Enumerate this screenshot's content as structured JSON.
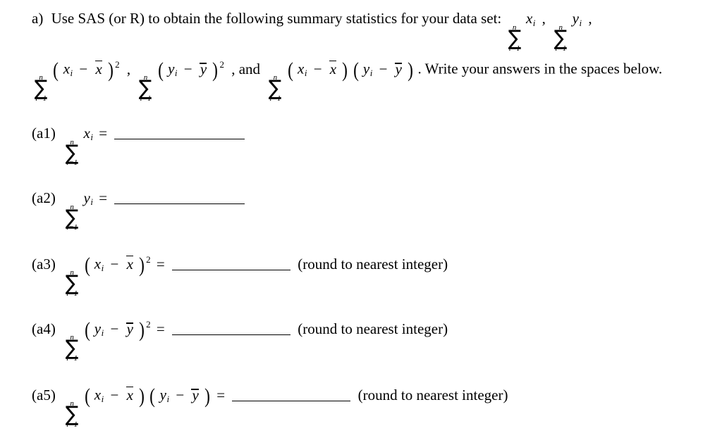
{
  "document": {
    "type": "math-worksheet-question",
    "font_color": "#000000",
    "background_color": "#ffffff"
  },
  "intro": {
    "part_label": "a)",
    "text_before": "Use SAS (or R) to obtain the following summary statistics for your data set:",
    "text_and": ", and",
    "text_after": ".  Write your answers in the spaces below.",
    "comma": ",",
    "period": "."
  },
  "symbols": {
    "sigma": "∑",
    "upper_limit": "n",
    "lower_limit": "i=1",
    "x": "x",
    "y": "y",
    "i": "i",
    "squared": "2",
    "equals": "=",
    "minus": "−",
    "paren_open": "(",
    "paren_close": ")"
  },
  "items": [
    {
      "id": "a1",
      "label": "(a1)",
      "expression": "sum of x_i",
      "equals": "=",
      "answer_value": "",
      "note": ""
    },
    {
      "id": "a2",
      "label": "(a2)",
      "expression": "sum of y_i",
      "equals": "=",
      "answer_value": "",
      "note": ""
    },
    {
      "id": "a3",
      "label": "(a3)",
      "expression": "sum of (x_i - xbar)^2",
      "equals": "=",
      "answer_value": "",
      "note": "(round to nearest integer)"
    },
    {
      "id": "a4",
      "label": "(a4)",
      "expression": "sum of (y_i - ybar)^2",
      "equals": "=",
      "answer_value": "",
      "note": "(round to nearest integer)"
    },
    {
      "id": "a5",
      "label": "(a5)",
      "expression": "sum of (x_i - xbar)(y_i - ybar)",
      "equals": "=",
      "answer_value": "",
      "note": "(round to nearest integer)"
    }
  ]
}
